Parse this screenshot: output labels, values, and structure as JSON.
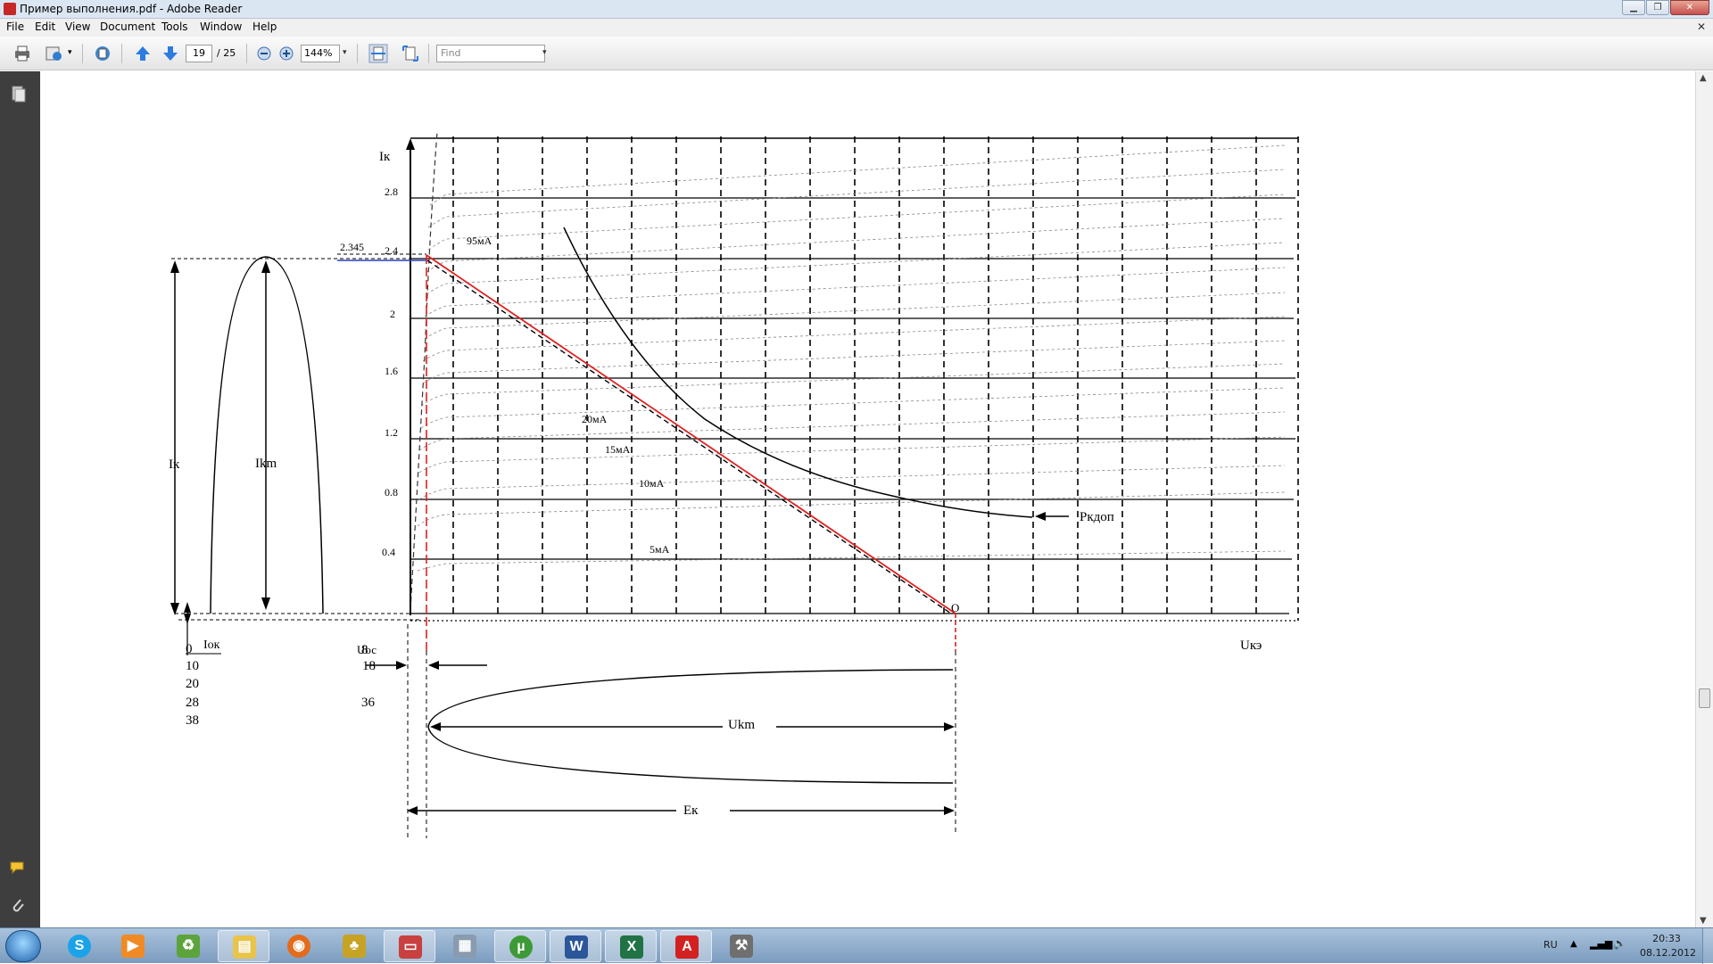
{
  "window": {
    "title": "Пример выполнения.pdf - Adobe Reader"
  },
  "menu": [
    "File",
    "Edit",
    "View",
    "Document",
    "Tools",
    "Window",
    "Help"
  ],
  "toolbar": {
    "page_current": "19",
    "page_total": "/ 25",
    "zoom": "144%",
    "find_placeholder": "Find"
  },
  "figure": {
    "y_axis_label": "Iк",
    "x_axis_label": "Uкэ",
    "y_ticks": [
      "2.8",
      "2.4",
      "2",
      "1.6",
      "1.2",
      "0.8",
      "0.4"
    ],
    "marker_value": "2.345",
    "curve_labels": [
      "95мА",
      "20мА",
      "15мА",
      "10мА",
      "5мА"
    ],
    "power_label": "Pкдоп",
    "point_label": "O",
    "ik_label": "Iк",
    "ikm_label": "Ikm",
    "iok_label": "Iок",
    "ukm_label": "Ukm",
    "ek_label": "Eк",
    "uoc_label": "Uос",
    "col_left": [
      "0",
      "10",
      "20",
      "28",
      "38"
    ],
    "col_right": [
      "8",
      "18",
      "36"
    ]
  },
  "chart_data": {
    "type": "line",
    "title": "",
    "xlabel": "Uкэ",
    "ylabel": "Iк",
    "ylim": [
      0,
      2.8
    ],
    "y_ticks": [
      0.4,
      0.8,
      1.2,
      1.6,
      2,
      2.4,
      2.8
    ],
    "series": [
      {
        "name": "95мА"
      },
      {
        "name": "20мА"
      },
      {
        "name": "15мА"
      },
      {
        "name": "10мА"
      },
      {
        "name": "5мА"
      },
      {
        "name": "Pкдоп"
      }
    ],
    "annotations": [
      "2.345",
      "O"
    ]
  },
  "taskbar": {
    "language": "RU",
    "time": "20:33",
    "date": "08.12.2012"
  }
}
